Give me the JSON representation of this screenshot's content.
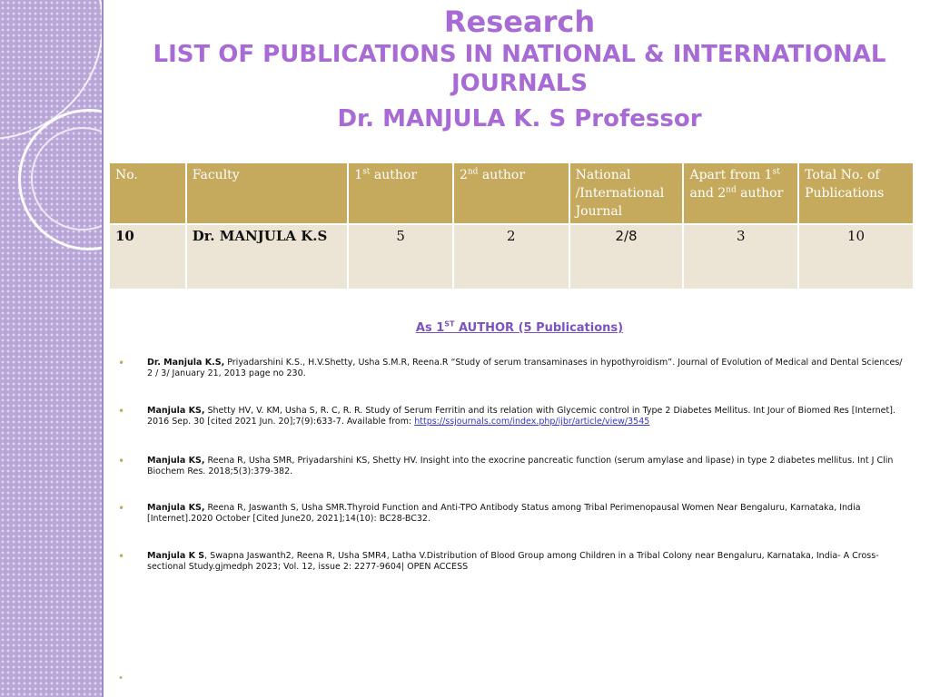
{
  "title": {
    "line1": "Research",
    "line2": "LIST OF PUBLICATIONS IN NATIONAL & INTERNATIONAL JOURNALS",
    "line3": "Dr. MANJULA K. S Professor"
  },
  "table": {
    "headers": {
      "no": "No.",
      "faculty": "Faculty",
      "first_num": "1",
      "first_sup": "st",
      "first_rest": " author",
      "second_num": "2",
      "second_sup": "nd",
      "second_rest": " author",
      "national": "National /International Journal",
      "apart_a": "Apart from 1",
      "apart_sup1": "st",
      "apart_b": "and 2",
      "apart_sup2": "nd",
      "apart_c": " author",
      "total": "Total No. of Publications"
    },
    "row": {
      "no": "10",
      "faculty": "Dr. MANJULA K.S",
      "first": "5",
      "second": "2",
      "national": "2/8",
      "apart": "3",
      "total": "10"
    }
  },
  "section": {
    "prefix": "As 1",
    "sup": "ST",
    "rest": " AUTHOR (5 Publications) "
  },
  "publications": [
    {
      "author": "Dr. Manjula K.S,",
      "text": " Priyadarshini K.S., H.V.Shetty, Usha S.M.R, Reena.R  “Study of serum transaminases in hypothyroidism”. Journal of Evolution of Medical and Dental Sciences/ 2 / 3/ January 21, 2013 page no 230."
    },
    {
      "author": "Manjula KS,",
      "text": " Shetty HV, V. KM, Usha S, R. C, R. R. Study of Serum Ferritin and its relation with Glycemic control in Type 2 Diabetes Mellitus. Int Jour of Biomed Res [Internet]. 2016 Sep. 30 [cited 2021 Jun. 20];7(9):633-7. Available from: ",
      "link": "https://ssjournals.com/index.php/ijbr/article/view/3545"
    },
    {
      "author": "Manjula KS,",
      "text": " Reena R, Usha SMR, Priyadarshini KS, Shetty HV. Insight into the exocrine pancreatic function (serum amylase and lipase) in type 2 diabetes mellitus. Int J Clin Biochem Res. 2018;5(3):379-382."
    },
    {
      "author": " Manjula KS,",
      "text": " Reena R, Jaswanth S, Usha SMR.Thyroid Function and Anti-TPO Antibody Status among Tribal Perimenopausal Women Near Bengaluru, Karnataka, India [Internet].2020 October [Cited June20, 2021];14(10): BC28-BC32."
    },
    {
      "author": "Manjula K S",
      "text": ", Swapna Jaswanth2, Reena R, Usha SMR4, Latha V.Distribution of Blood Group among Children in a Tribal Colony near Bengaluru, Karnataka, India- A Cross-sectional Study.gjmedph 2023; Vol. 12, issue 2: 2277-9604| OPEN ACCESS"
    }
  ],
  "bullet_char": "•",
  "colors": {
    "title": "#a86ad4",
    "header_bg": "#c5a95c",
    "row_bg": "#ece5d6",
    "sidebar": "#b9a6d8",
    "link": "#3333cc"
  }
}
